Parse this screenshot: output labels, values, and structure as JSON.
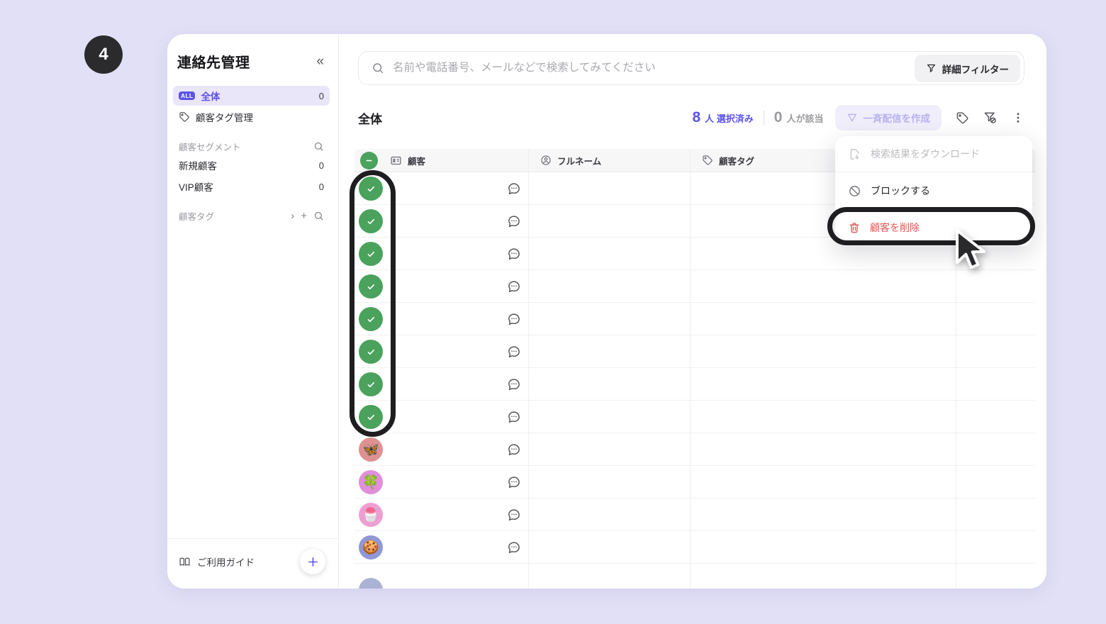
{
  "page": {
    "step_badge": "4",
    "background": "#e2e0f6"
  },
  "colors": {
    "accent": "#5b53e8",
    "accent_light_bg": "#e9e6fa",
    "disabled_button_bg": "#f0eefb",
    "disabled_button_text": "#b8b0f0",
    "selected_green": "#4aa25c",
    "danger_red": "#e25555",
    "annotation_black": "#1e1e20"
  },
  "sidebar": {
    "title": "連絡先管理",
    "collapse_icon": "«",
    "items": [
      {
        "label": "全体",
        "badge": "ALL",
        "count": "0"
      },
      {
        "label": "顧客タグ管理"
      }
    ],
    "segments_header": "顧客セグメント",
    "segments": [
      {
        "label": "新規顧客",
        "count": "0"
      },
      {
        "label": "VIP顧客",
        "count": "0"
      }
    ],
    "tags_header": "顧客タグ",
    "tags_chevron": "›",
    "tags_plus": "+",
    "guide_label": "ご利用ガイド"
  },
  "search": {
    "placeholder": "名前や電話番号、メールなどで検索してみてください",
    "filter_button": "詳細フィルター"
  },
  "toolbar": {
    "title": "全体",
    "selected_count": "8",
    "selected_label": "人 選択済み",
    "matched_count": "0",
    "matched_label": "人が該当",
    "broadcast_button": "一斉配信を作成"
  },
  "table": {
    "columns": [
      {
        "label": "顧客",
        "icon": "contact-card-icon"
      },
      {
        "label": "フルネーム",
        "icon": "person-icon"
      },
      {
        "label": "顧客タグ",
        "icon": "tag-icon"
      },
      {
        "label": ""
      }
    ],
    "rows": [
      {
        "type": "selected"
      },
      {
        "type": "selected"
      },
      {
        "type": "selected"
      },
      {
        "type": "selected"
      },
      {
        "type": "selected"
      },
      {
        "type": "selected"
      },
      {
        "type": "selected"
      },
      {
        "type": "selected"
      },
      {
        "type": "emoji",
        "emoji": "🦋",
        "bg": "#df9191"
      },
      {
        "type": "emoji",
        "emoji": "🍀",
        "bg": "#e08fd8"
      },
      {
        "type": "emoji",
        "emoji": "🍧",
        "bg": "#ee9fd2"
      },
      {
        "type": "emoji",
        "emoji": "🍪",
        "bg": "#8f97d8"
      }
    ],
    "partial_row": {
      "type": "partial",
      "bg": "#aab3d4"
    }
  },
  "menu": {
    "items": [
      {
        "label": "検索結果をダウンロード",
        "state": "disabled",
        "icon": "file-download-icon"
      },
      {
        "label": "ブロックする",
        "state": "normal",
        "icon": "block-icon"
      },
      {
        "label": "顧客を削除",
        "state": "danger",
        "icon": "trash-icon"
      }
    ]
  },
  "icons": {
    "search": "magnifier",
    "filter": "funnel",
    "broadcast": "send-nabla",
    "tag": "price-tag",
    "filter_off": "funnel-slash",
    "kebab": "three-dots-vertical",
    "chat": "speech-bubble-ellipsis",
    "guide": "open-book",
    "add": "plus"
  }
}
